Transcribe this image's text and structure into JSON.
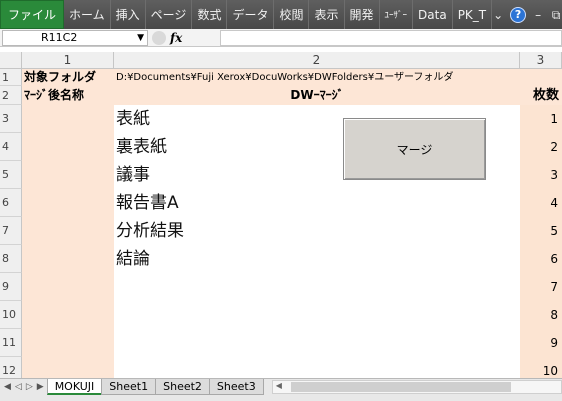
{
  "ribbon": {
    "tabs": [
      "ファイル",
      "ホーム",
      "挿入",
      "ページ",
      "数式",
      "データ",
      "校閲",
      "表示",
      "開発",
      "ﾕｰｻﾞｰ",
      "Data",
      "PK_T"
    ],
    "icons": [
      "chevron-down-icon",
      "help-icon",
      "minimize-icon",
      "restore-icon"
    ]
  },
  "formula_bar": {
    "name_box": "R11C2",
    "fx_label": "fx",
    "formula": ""
  },
  "columns": [
    "1",
    "2",
    "3"
  ],
  "rows": [
    "1",
    "2",
    "3",
    "4",
    "5",
    "6",
    "7",
    "8",
    "9",
    "10",
    "11",
    "12"
  ],
  "sheet": {
    "row1_label": "対象フォルダ",
    "row1_path": "D:¥Documents¥Fuji Xerox¥DocuWorks¥DWFolders¥ユーザーフォルダ",
    "row2_col1": "ﾏｰｼﾞ後名称",
    "row2_col2": "DWｰﾏｰｼﾞ",
    "row2_col3": "枚数",
    "documents": [
      "表紙",
      "裏表紙",
      "議事",
      "報告書A",
      "分析結果",
      "結論"
    ],
    "page_numbers": [
      "1",
      "2",
      "3",
      "4",
      "5",
      "6",
      "7",
      "8",
      "9",
      "10"
    ],
    "merge_button": "マージ"
  },
  "sheet_tabs": {
    "tabs": [
      "MOKUJI",
      "Sheet1",
      "Sheet2",
      "Sheet3"
    ],
    "active": "MOKUJI"
  }
}
